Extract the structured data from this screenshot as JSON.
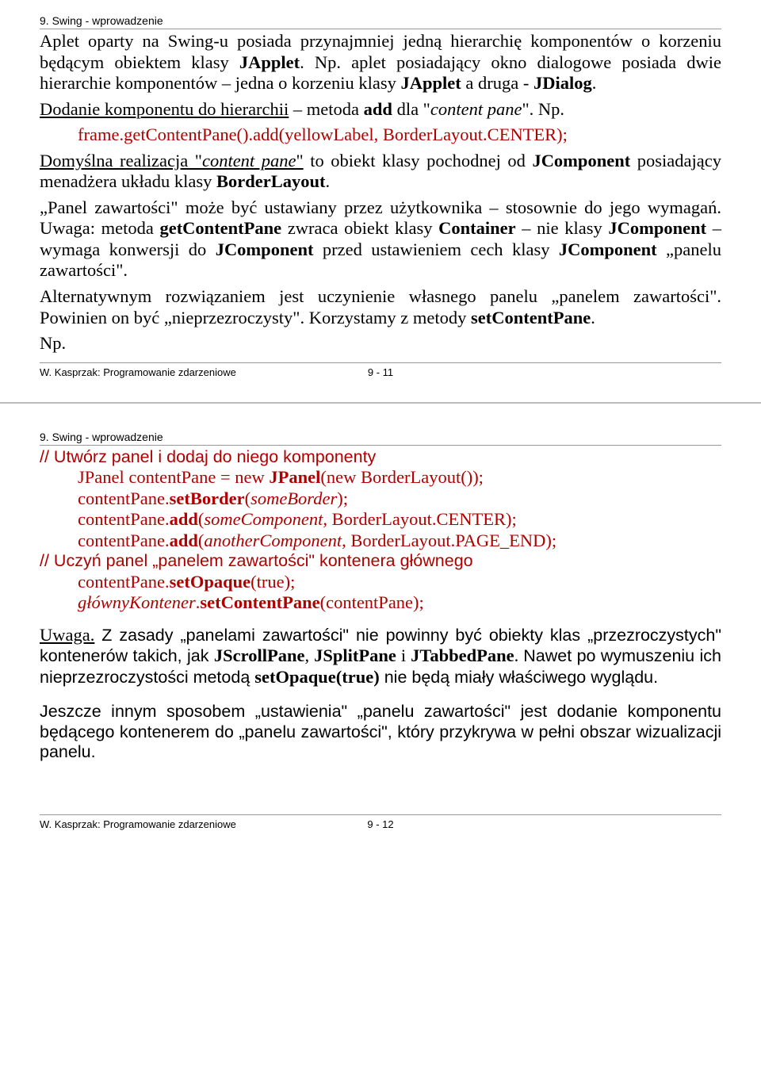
{
  "page1": {
    "header": "9. Swing - wprowadzenie",
    "p1_a": "Aplet oparty na Swing-u posiada przynajmniej jedną hierarchię komponentów o korzeniu będącym obiektem klasy ",
    "p1_b": "JApplet",
    "p1_c": ". Np. aplet posiadający okno dialogowe posiada dwie hierarchie komponentów – jedna o korzeniu klasy ",
    "p1_d": "JApplet",
    "p1_e": " a druga - ",
    "p1_f": "JDialog",
    "p1_g": ".",
    "p2_a": "Dodanie komponentu do hierarchii",
    "p2_b": " – metoda ",
    "p2_c": "add",
    "p2_d": " dla \"",
    "p2_e": "content pane",
    "p2_f": "\". Np.",
    "code1": "frame.getContentPane().add(yellowLabel, BorderLayout.CENTER);",
    "p3_a": "Domyślna realizacja \"",
    "p3_b": "content pane",
    "p3_c": "\"",
    "p3_d": " to obiekt klasy pochodnej od ",
    "p3_e": "JComponent",
    "p3_f": " posiadający menadżera układu klasy ",
    "p3_g": "BorderLayout",
    "p3_h": ".",
    "p4_a": "„Panel zawartości\" może być ustawiany przez użytkownika – stosownie do jego wymagań. Uwaga: metoda ",
    "p4_b": "getContentPane",
    "p4_c": " zwraca obiekt klasy ",
    "p4_d": "Container",
    "p4_e": " – nie klasy ",
    "p4_f": "JComponent",
    "p4_g": " – wymaga konwersji do ",
    "p4_h": "JComponent",
    "p4_i": " przed ustawieniem cech klasy ",
    "p4_j": "JComponent",
    "p4_k": " „panelu zawartości\".",
    "p5_a": "Alternatywnym rozwiązaniem jest uczynienie własnego panelu „panelem zawartości\". Powinien on być „nieprzezroczysty\". Korzystamy z metody ",
    "p5_b": "setContentPane",
    "p5_c": ".",
    "p6": "Np.",
    "footer_left": "W. Kasprzak: Programowanie zdarzeniowe",
    "footer_center": "9 - 11"
  },
  "page2": {
    "header": "9. Swing - wprowadzenie",
    "c1": "// Utwórz panel i dodaj do niego komponenty",
    "c2_a": "JPanel contentPane = new ",
    "c2_b": "JPanel",
    "c2_c": "(new BorderLayout());",
    "c3_a": "contentPane.",
    "c3_b": "setBorder",
    "c3_c": "(",
    "c3_d": "someBorder",
    "c3_e": ");",
    "c4_a": "contentPane.",
    "c4_b": "add",
    "c4_c": "(",
    "c4_d": "someComponent",
    "c4_e": ", BorderLayout.CENTER);",
    "c5_a": "contentPane.",
    "c5_b": "add",
    "c5_c": "(",
    "c5_d": "anotherComponent",
    "c5_e": ", BorderLayout.PAGE_END);",
    "c6": "// Uczyń panel „panelem zawartości\" kontenera głównego",
    "c7_a": "contentPane.",
    "c7_b": "setOpaque",
    "c7_c": "(true);",
    "c8_a": "głównyKontener",
    "c8_b": ".",
    "c8_c": "setContentPane",
    "c8_d": "(contentPane);",
    "p1_a": "Uwaga.",
    "p1_b": " Z zasady „panelami zawartości\" nie powinny być obiekty klas „przezroczystych\" kontenerów takich, jak ",
    "p1_c": "JScrollPane",
    "p1_d": ", ",
    "p1_e": "JSplitPane",
    "p1_f": " i ",
    "p1_g": "JTabbedPane",
    "p1_h": ". ",
    "p1_i": "Nawet po wymuszeniu ich nieprzezroczystości metodą ",
    "p1_j": "setOpaque(true)",
    "p1_k": " nie będą miały właściwego wyglądu.",
    "p2": "Jeszcze innym sposobem „ustawienia\" „panelu zawartości\" jest dodanie komponentu będącego kontenerem do „panelu zawartości\", który przykrywa w pełni obszar wizualizacji panelu.",
    "footer_left": "W. Kasprzak: Programowanie zdarzeniowe",
    "footer_center": "9 - 12"
  }
}
